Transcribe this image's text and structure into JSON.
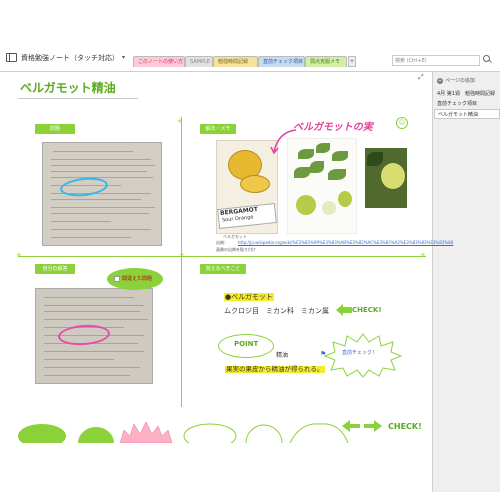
{
  "notebook": {
    "title": "資格勉強ノート（タッチ対応）",
    "caret": "▾"
  },
  "tabs": [
    {
      "label": "このノートの使い方",
      "color": "#ffc9d6"
    },
    {
      "label": "SAMPLE",
      "color": "#e1e1e1"
    },
    {
      "label": "勉強時間記録",
      "color": "#f6e29c"
    },
    {
      "label": "直前チェック項目",
      "color": "#c8d9f2"
    },
    {
      "label": "弱点克服メモ",
      "color": "#d4eea6"
    }
  ],
  "tab_add": "+",
  "search": {
    "placeholder": "検索 (Ctrl+E)",
    "icon": "search-icon"
  },
  "right_panel": {
    "add_page": "ページの追加",
    "pages": [
      "4月 第1週　勉強時間記録",
      "直前チェック項目",
      "ベルガモット精油"
    ]
  },
  "page": {
    "title": "ベルガモット精油",
    "labels": {
      "question": "問題",
      "answer": "解法・メモ",
      "my_answer": "自分の解答",
      "memorize": "覚えるべきこと"
    },
    "annotation": "ベルガモットの実",
    "smiley": "☺",
    "bergamot_box": {
      "line1": "BERGAMOT",
      "line2": "Sour Orange",
      "caption": "ベルガモット"
    },
    "link_prefix": "出典：",
    "link": "http://ja.wikipedia.org/wiki/%E3%83%99%E3%83%AB%E3%82%AC%E3%83%A2%E3%83%83%E3%83%88",
    "link_caption": "画像の出典を貼り付け",
    "mistake": "間違えた問題",
    "memory": {
      "bergamot": "●ベルガモット",
      "citrus": "ムクロジ目　ミカン科　ミカン属",
      "check": "CHECK!",
      "point": "POINT",
      "oil": "精油",
      "fact": "果実の果皮から精油が得られる。",
      "review": "直前チェック！"
    },
    "bottom_check": "CHECK!"
  },
  "colors": {
    "accent": "#8bd23a",
    "title": "#5aaa1e",
    "pink": "#e6409c",
    "blue": "#39b6e8",
    "highlight": "#f4ec2a"
  }
}
